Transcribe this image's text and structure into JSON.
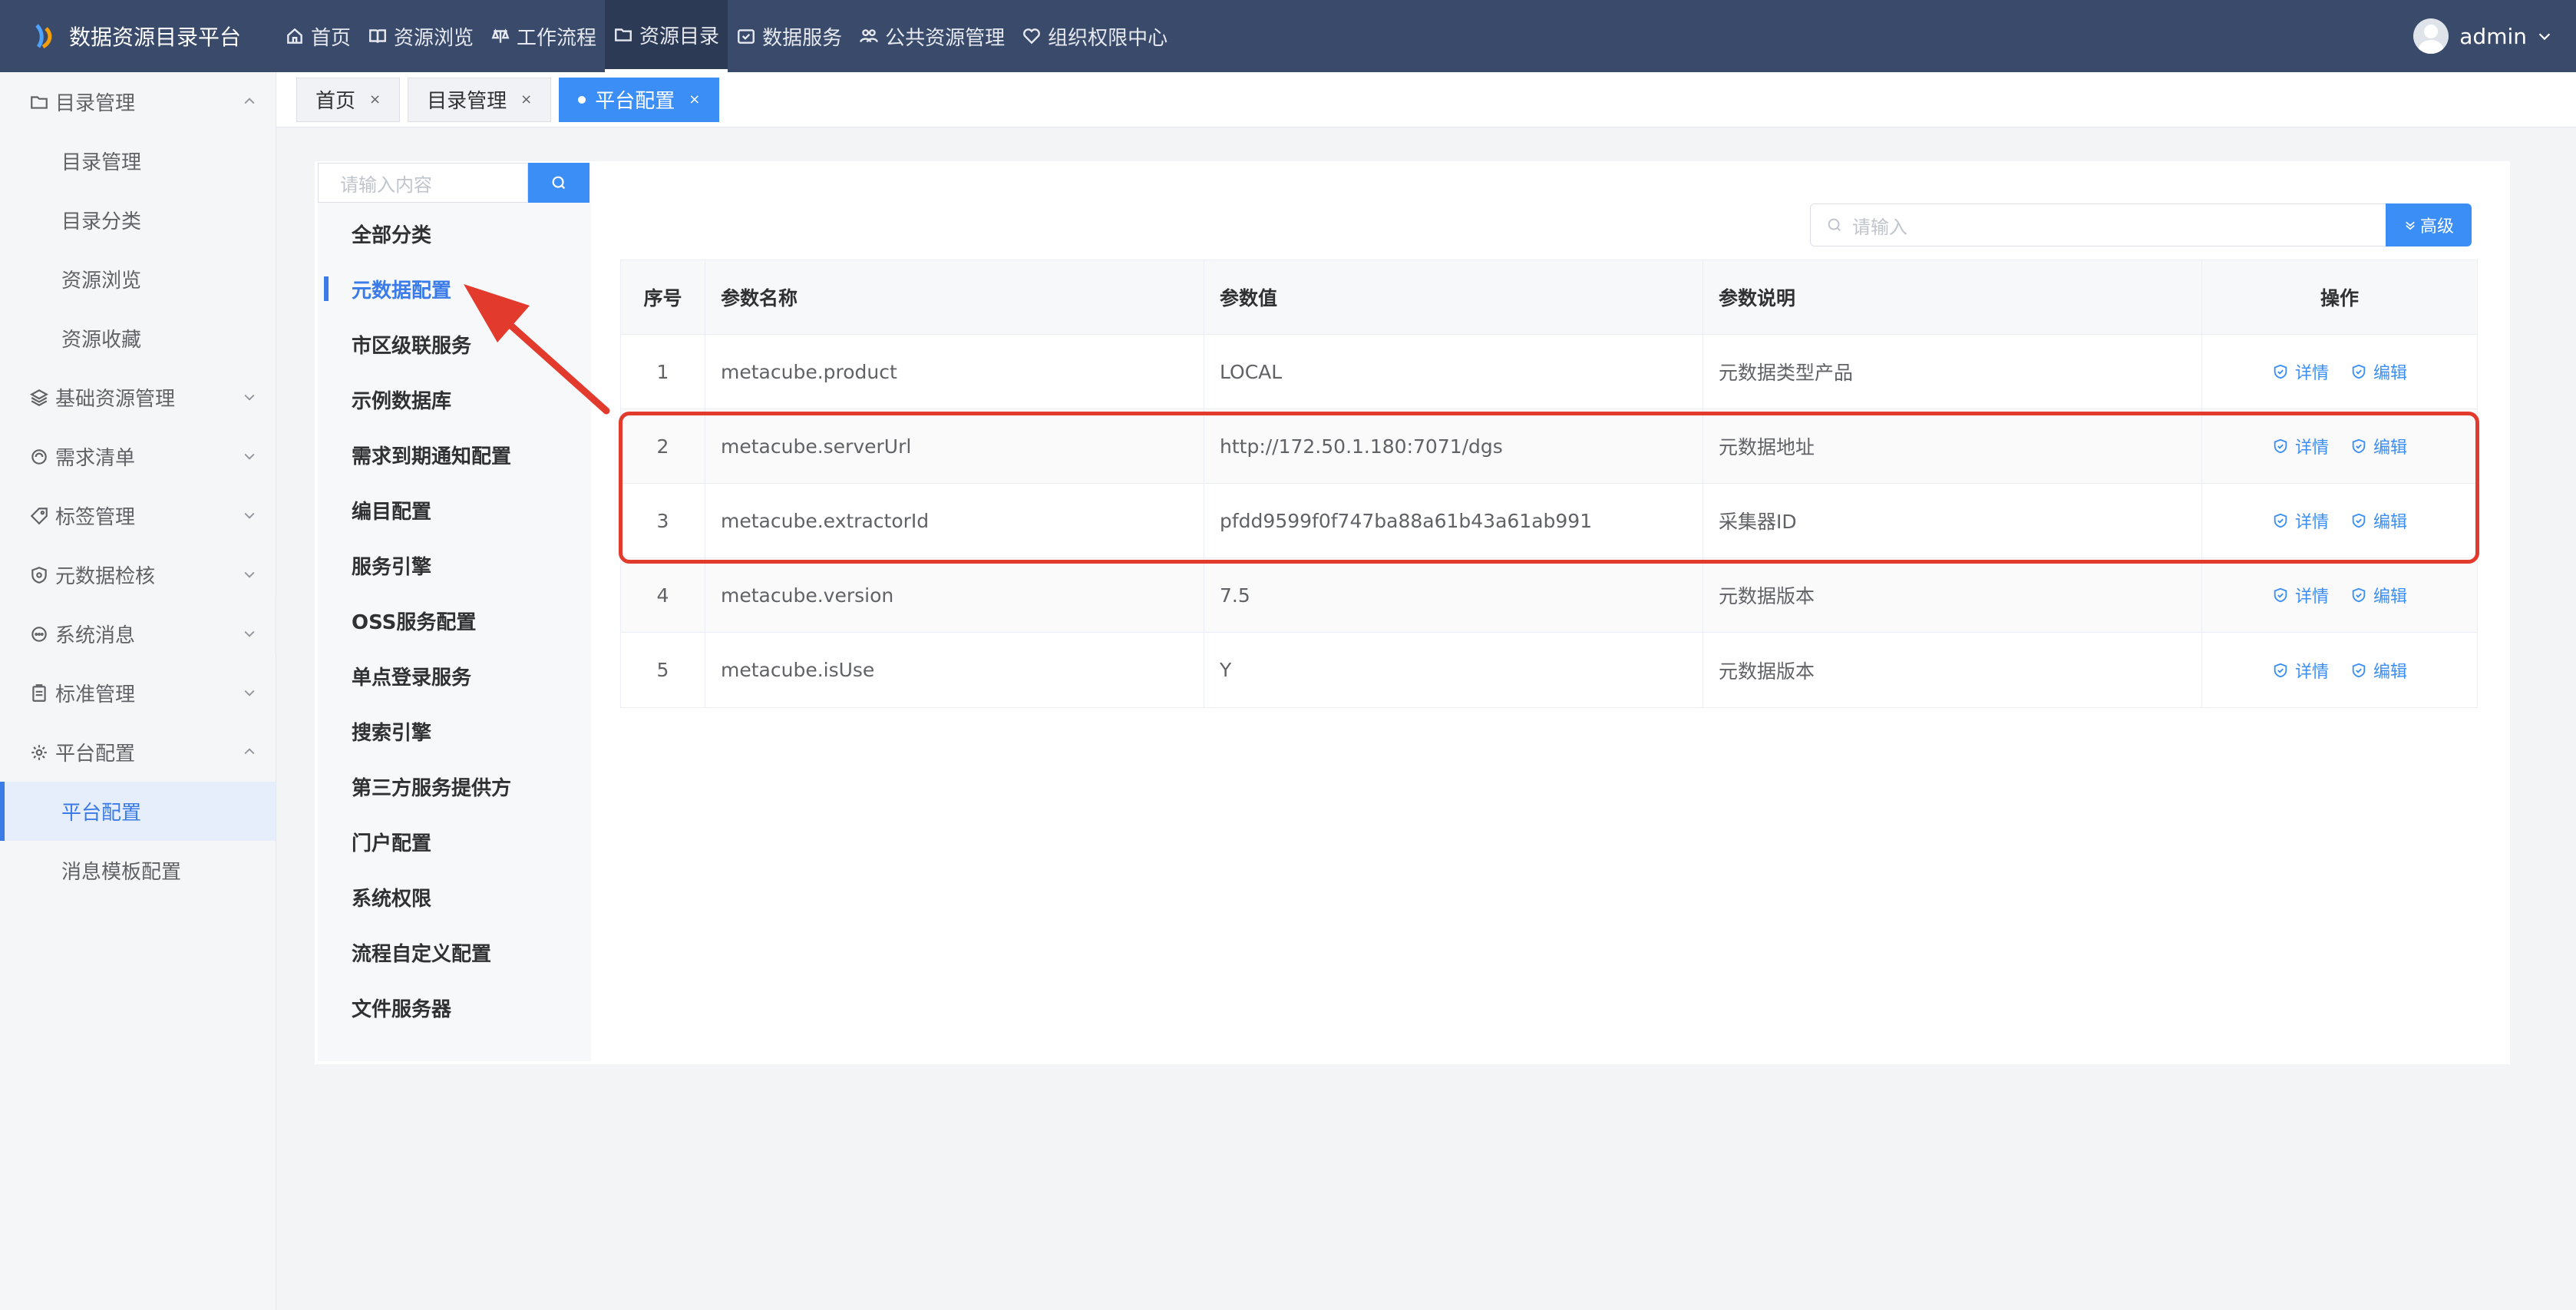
{
  "app": {
    "title": "数据资源目录平台"
  },
  "nav": [
    {
      "label": "首页",
      "icon": "home-icon"
    },
    {
      "label": "资源浏览",
      "icon": "book-icon"
    },
    {
      "label": "工作流程",
      "icon": "flow-icon"
    },
    {
      "label": "资源目录",
      "icon": "folder-icon",
      "active": true
    },
    {
      "label": "数据服务",
      "icon": "calendar-check-icon"
    },
    {
      "label": "公共资源管理",
      "icon": "users-icon"
    },
    {
      "label": "组织权限中心",
      "icon": "heart-icon"
    }
  ],
  "user": {
    "name": "admin"
  },
  "sidebar": {
    "groups": [
      {
        "label": "目录管理",
        "icon": "folder-icon",
        "expanded": true,
        "items": [
          {
            "label": "目录管理"
          },
          {
            "label": "目录分类"
          },
          {
            "label": "资源浏览"
          },
          {
            "label": "资源收藏"
          }
        ]
      },
      {
        "label": "基础资源管理",
        "icon": "layers-icon"
      },
      {
        "label": "需求清单",
        "icon": "link-icon"
      },
      {
        "label": "标签管理",
        "icon": "tag-icon"
      },
      {
        "label": "元数据检核",
        "icon": "shield-icon"
      },
      {
        "label": "系统消息",
        "icon": "chat-icon"
      },
      {
        "label": "标准管理",
        "icon": "clipboard-icon"
      },
      {
        "label": "平台配置",
        "icon": "gear-icon",
        "expanded": true,
        "items": [
          {
            "label": "平台配置",
            "active": true
          },
          {
            "label": "消息模板配置"
          }
        ]
      }
    ]
  },
  "tabs": [
    {
      "label": "首页",
      "close": "×"
    },
    {
      "label": "目录管理",
      "close": "×"
    },
    {
      "label": "平台配置",
      "close": "×",
      "active": true
    }
  ],
  "category": {
    "search_placeholder": "请输入内容",
    "items": [
      "全部分类",
      "元数据配置",
      "市区级联服务",
      "示例数据库",
      "需求到期通知配置",
      "编目配置",
      "服务引擎",
      "OSS服务配置",
      "单点登录服务",
      "搜索引擎",
      "第三方服务提供方",
      "门户配置",
      "系统权限",
      "流程自定义配置",
      "文件服务器"
    ],
    "active_index": 1
  },
  "table": {
    "search_placeholder": "请输入",
    "advanced_label": "高级",
    "headers": [
      "序号",
      "参数名称",
      "参数值",
      "参数说明",
      "操作"
    ],
    "rows": [
      {
        "no": "1",
        "name": "metacube.product",
        "value": "LOCAL",
        "desc": "元数据类型产品"
      },
      {
        "no": "2",
        "name": "metacube.serverUrl",
        "value": "http://172.50.1.180:7071/dgs",
        "desc": "元数据地址"
      },
      {
        "no": "3",
        "name": "metacube.extractorId",
        "value": "pfdd9599f0f747ba88a61b43a61ab991",
        "desc": "采集器ID"
      },
      {
        "no": "4",
        "name": "metacube.version",
        "value": "7.5",
        "desc": "元数据版本"
      },
      {
        "no": "5",
        "name": "metacube.isUse",
        "value": "Y",
        "desc": "元数据版本"
      }
    ],
    "actions": {
      "detail": "详情",
      "edit": "编辑"
    }
  },
  "colors": {
    "header_bg": "#3a4a6a",
    "accent": "#3a8ef6",
    "annotation": "#e23b2e"
  }
}
